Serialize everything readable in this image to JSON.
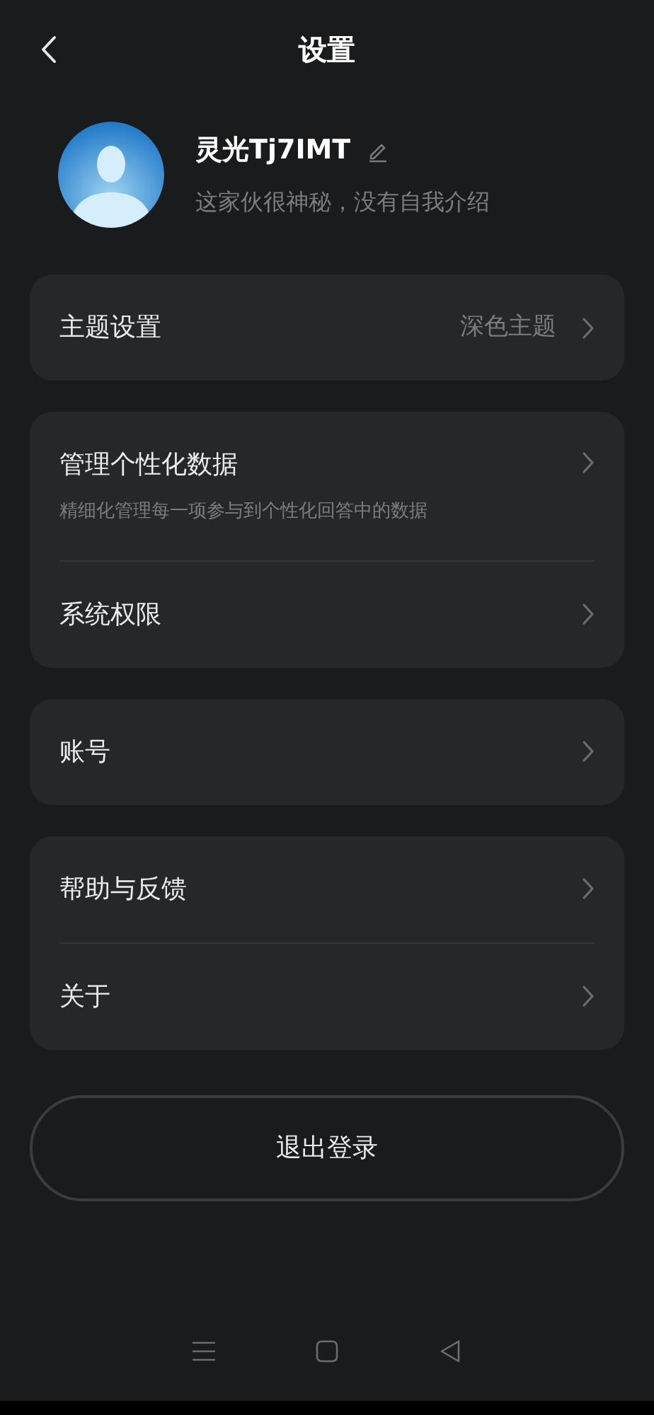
{
  "header": {
    "title": "设置"
  },
  "profile": {
    "name": "灵光Tj7IMT",
    "bio": "这家伙很神秘，没有自我介绍"
  },
  "groups": [
    {
      "items": [
        {
          "label": "主题设置",
          "value": "深色主题"
        }
      ]
    },
    {
      "items": [
        {
          "label": "管理个性化数据",
          "subtitle": "精细化管理每一项参与到个性化回答中的数据"
        },
        {
          "label": "系统权限"
        }
      ]
    },
    {
      "items": [
        {
          "label": "账号"
        }
      ]
    },
    {
      "items": [
        {
          "label": "帮助与反馈"
        },
        {
          "label": "关于"
        }
      ]
    }
  ],
  "logout_button": "退出登录"
}
